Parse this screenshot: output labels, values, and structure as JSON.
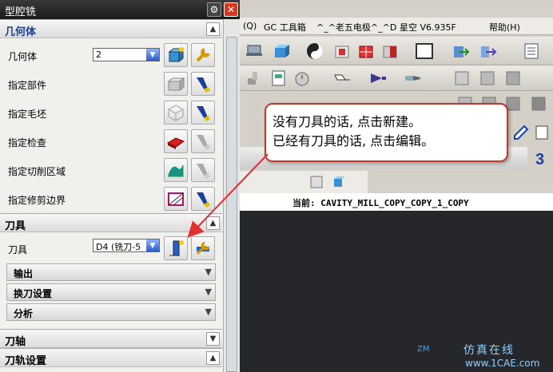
{
  "dialog": {
    "title": "型腔铣",
    "sections": {
      "geometry": "几何体",
      "tool": "刀具",
      "axis": "刀轴",
      "toolpath": "刀轨设置"
    },
    "geometry_rows": {
      "geometry_label": "几何体",
      "geometry_value": "2",
      "part": "指定部件",
      "blank": "指定毛坯",
      "check": "指定检查",
      "cut_area": "指定切削区域",
      "trim": "指定修剪边界"
    },
    "tool_row": {
      "label": "刀具",
      "value": "D4 (铣刀-5"
    },
    "subsections": {
      "output": "输出",
      "tool_change": "换刀设置",
      "analysis": "分析"
    }
  },
  "menubar": {
    "item1": "(Q)",
    "item2": "GC 工具箱",
    "item3": "^_^老五电极^_^D",
    "item4": "星空 V6.935F",
    "item5": "帮助(H)"
  },
  "status": {
    "current_label": "当前:",
    "current_value": "CAVITY_MILL_COPY_COPY_1_COPY"
  },
  "callout": {
    "line1": "没有刀具的话, 点击新建。",
    "line2": "已经有刀具的话, 点击编辑。"
  },
  "viewport": {
    "axis_label": "ZM",
    "watermark_line1": "仿真在线",
    "watermark_line2": "www.1CAE.com"
  },
  "colors": {
    "callout_border": "#c0392b",
    "arrow": "#e03030",
    "close_button": "#d9381e",
    "viewport_bg": "#25272b"
  }
}
